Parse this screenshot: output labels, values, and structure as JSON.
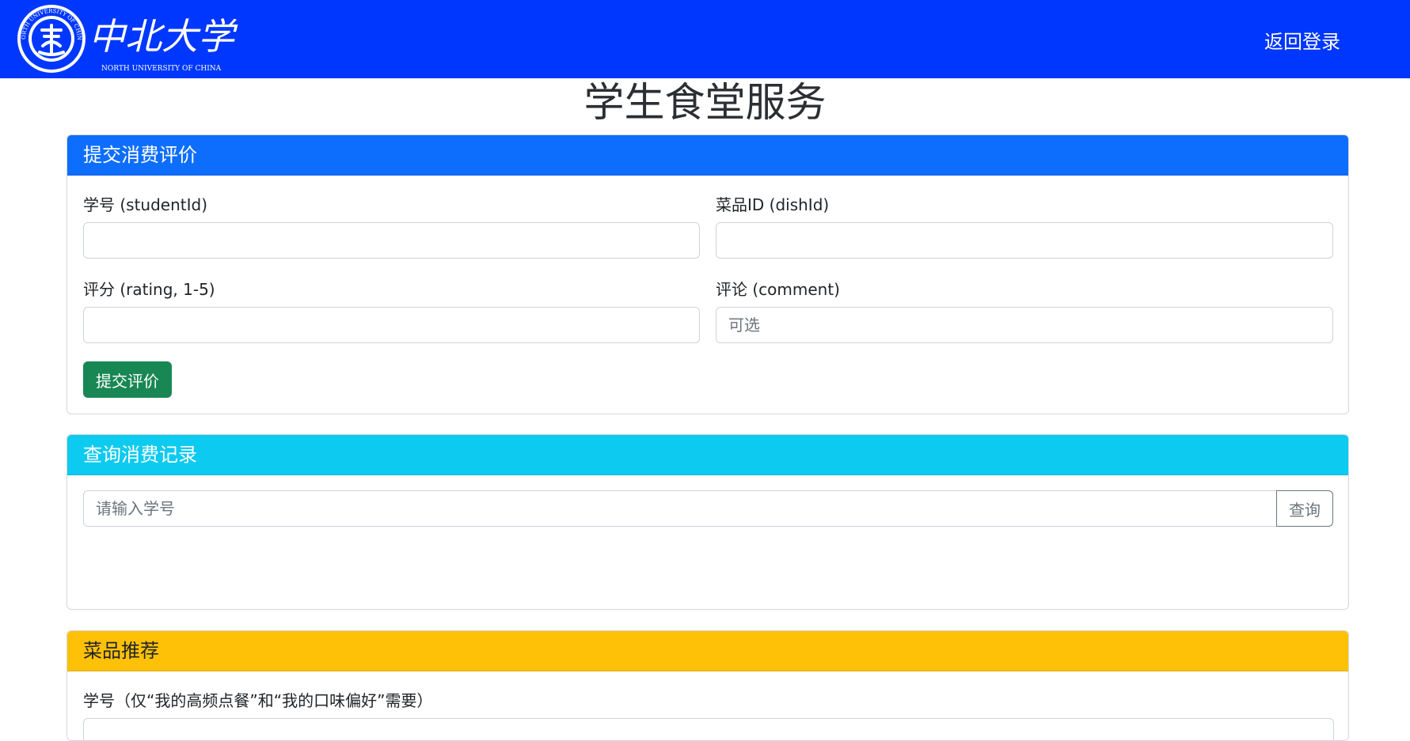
{
  "header": {
    "logo_text": "中北大学",
    "logo_subtitle": "NORTH UNIVERSITY OF CHINA",
    "seal_text": "NORTH UNIVERSITY OF CHINA",
    "logout_label": "返回登录",
    "brand_color": "#0037ff"
  },
  "page": {
    "title": "学生食堂服务"
  },
  "review_card": {
    "title": "提交消费评价",
    "header_color": "#0d6efd",
    "student_id_label": "学号 (studentId)",
    "student_id_value": "",
    "dish_id_label": "菜品ID (dishId)",
    "dish_id_value": "",
    "rating_label": "评分 (rating, 1-5)",
    "rating_value": "",
    "comment_label": "评论 (comment)",
    "comment_placeholder": "可选",
    "submit_label": "提交评价"
  },
  "records_card": {
    "title": "查询消费记录",
    "header_color": "#0dcaf0",
    "search_placeholder": "请输入学号",
    "query_label": "查询"
  },
  "recommend_card": {
    "title": "菜品推荐",
    "header_color": "#ffc107",
    "student_id_label": "学号（仅“我的高频点餐”和“我的口味偏好”需要）"
  }
}
